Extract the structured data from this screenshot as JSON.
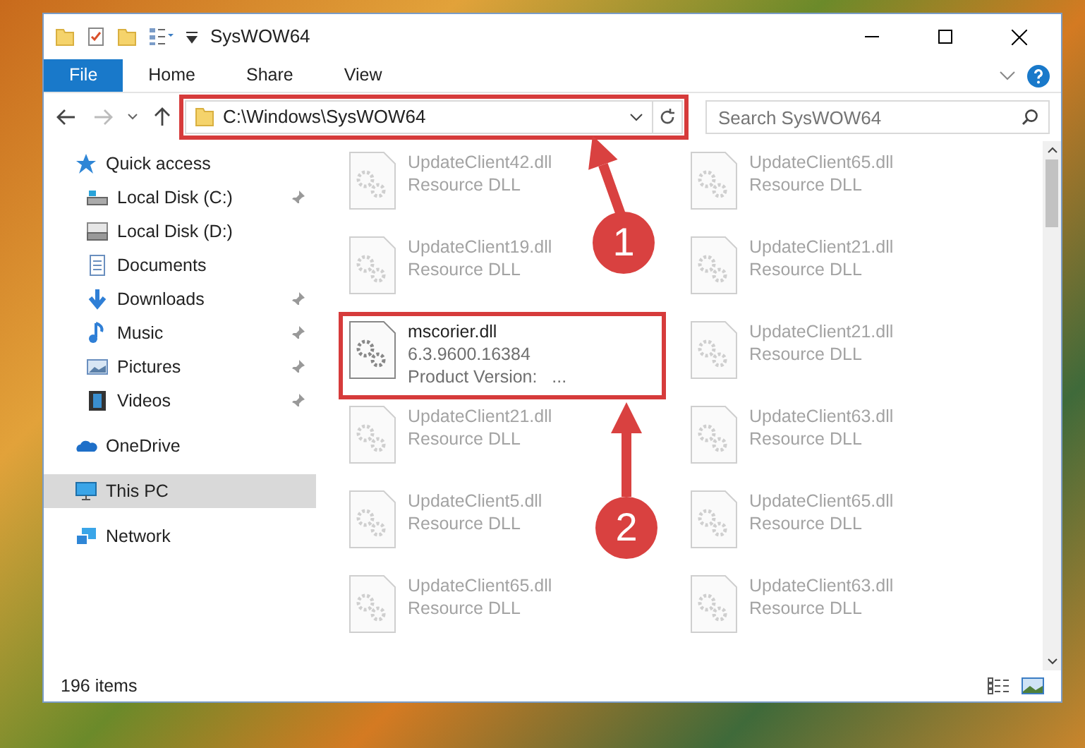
{
  "window": {
    "title": "SysWOW64"
  },
  "ribbon_tabs": [
    {
      "label": "File",
      "selected": true
    },
    {
      "label": "Home",
      "selected": false
    },
    {
      "label": "Share",
      "selected": false
    },
    {
      "label": "View",
      "selected": false
    }
  ],
  "address_bar": {
    "path": "C:\\Windows\\SysWOW64",
    "highlighted": true
  },
  "search": {
    "placeholder": "Search SysWOW64"
  },
  "sidebar": {
    "items": [
      {
        "label": "Quick access",
        "pinned": false,
        "selected": false,
        "children": [
          {
            "label": "Local Disk (C:)",
            "pinned": true,
            "selected": false
          },
          {
            "label": "Local Disk (D:)",
            "pinned": false,
            "selected": false
          },
          {
            "label": "Documents",
            "pinned": false,
            "selected": false
          },
          {
            "label": "Downloads",
            "pinned": true,
            "selected": false
          },
          {
            "label": "Music",
            "pinned": true,
            "selected": false
          },
          {
            "label": "Pictures",
            "pinned": true,
            "selected": false
          },
          {
            "label": "Videos",
            "pinned": true,
            "selected": false
          }
        ]
      },
      {
        "label": "OneDrive",
        "pinned": false,
        "selected": false
      },
      {
        "label": "This PC",
        "pinned": false,
        "selected": true
      },
      {
        "label": "Network",
        "pinned": false,
        "selected": false
      }
    ]
  },
  "files": [
    {
      "name": "UpdateClient42.dll",
      "line_2": "Resource DLL",
      "blurred": true,
      "highlighted": false
    },
    {
      "name": "UpdateClient65.dll",
      "line_2": "Resource DLL",
      "blurred": true,
      "highlighted": false
    },
    {
      "name": "UpdateClient19.dll",
      "line_2": "Resource DLL",
      "blurred": true,
      "highlighted": false
    },
    {
      "name": "UpdateClient21.dll",
      "line_2": "Resource DLL",
      "blurred": true,
      "highlighted": false
    },
    {
      "name": "mscorier.dll",
      "line_2": "6.3.9600.16384",
      "line_3": "Product Version:   ...",
      "blurred": false,
      "highlighted": true
    },
    {
      "name": "UpdateClient21.dll",
      "line_2": "Resource DLL",
      "blurred": true,
      "highlighted": false
    },
    {
      "name": "UpdateClient21.dll",
      "line_2": "Resource DLL",
      "blurred": true,
      "highlighted": false
    },
    {
      "name": "UpdateClient63.dll",
      "line_2": "Resource DLL",
      "blurred": true,
      "highlighted": false
    },
    {
      "name": "UpdateClient5.dll",
      "line_2": "Resource DLL",
      "blurred": true,
      "highlighted": false
    },
    {
      "name": "UpdateClient65.dll",
      "line_2": "Resource DLL",
      "blurred": true,
      "highlighted": false
    },
    {
      "name": "UpdateClient65.dll",
      "line_2": "Resource DLL",
      "blurred": true,
      "highlighted": false
    },
    {
      "name": "UpdateClient63.dll",
      "line_2": "Resource DLL",
      "blurred": true,
      "highlighted": false
    }
  ],
  "status_bar": {
    "item_count": "196 items"
  },
  "callouts": [
    {
      "number": "1"
    },
    {
      "number": "2"
    }
  ]
}
